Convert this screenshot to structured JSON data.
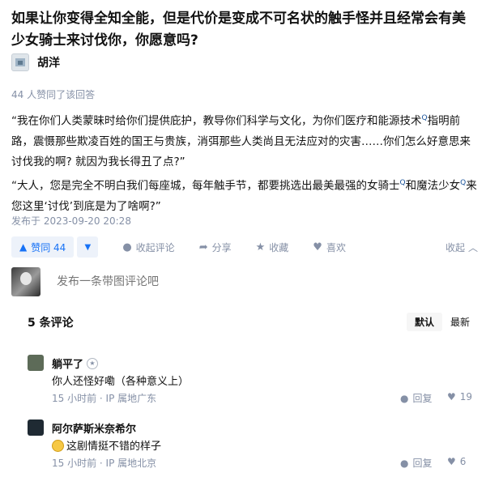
{
  "question": {
    "title": "如果让你变得全知全能，但是代价是变成不可名状的触手怪并且经常会有美少女骑士来讨伐你，你愿意吗?"
  },
  "author": {
    "name": "胡洋"
  },
  "answer": {
    "agree_text": "44 人赞同了该回答",
    "para1_a": "“我在你们人类蒙昧时给你们提供庇护，教导你们科学与文化，为你们医疗和能源技术",
    "para1_b": "指明前路，震慑那些欺凌百姓的国王与贵族，消弭那些人类尚且无法应对的灾害……你们怎么好意思来讨伐我的啊? 就因为我长得丑了点?”",
    "para2_a": "“大人，您是完全不明白我们每座城，每年触手节，都要挑选出最美最强的女骑士",
    "para2_b": "和魔法少女",
    "para2_c": "来您这里‘讨伐’到底是为了啥啊?”",
    "search_mark": "Q",
    "pubdate": "发布于 2023-09-20 20:28"
  },
  "actions": {
    "upvote": "赞同 44",
    "comment": "收起评论",
    "share": "分享",
    "favorite": "收藏",
    "like": "喜欢",
    "collapse": "收起"
  },
  "composer": {
    "placeholder": "发布一条带图评论吧"
  },
  "comments_header": {
    "count": "5 条评论",
    "sort_default": "默认",
    "sort_latest": "最新"
  },
  "comments": [
    {
      "name": "躺平了",
      "text": "你人还怪好嘞（各种意义上）",
      "meta": "15 小时前 · IP 属地广东",
      "reply": "回复",
      "likes": "19"
    },
    {
      "name": "阿尔萨斯米奈希尔",
      "text": "这剧情挺不错的样子",
      "meta": "15 小时前 · IP 属地北京",
      "reply": "回复",
      "likes": "6"
    }
  ],
  "colors": {
    "accent": "#1772f6",
    "meta": "#8590a6",
    "text": "#121212",
    "link": "#175199"
  }
}
